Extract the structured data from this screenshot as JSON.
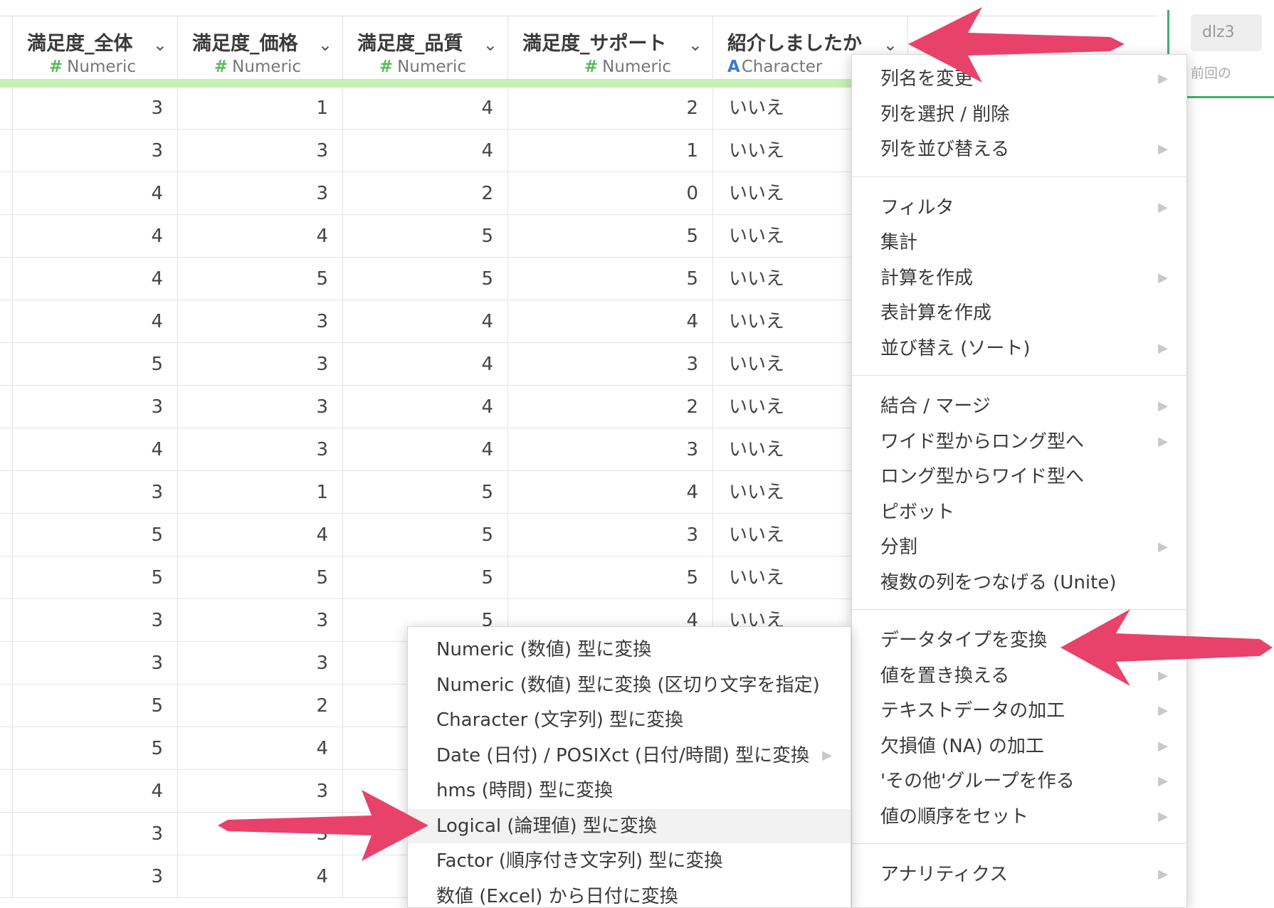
{
  "columns": [
    {
      "name": "満足度_全体",
      "type": "Numeric",
      "kind": "num"
    },
    {
      "name": "満足度_価格",
      "type": "Numeric",
      "kind": "num"
    },
    {
      "name": "満足度_品質",
      "type": "Numeric",
      "kind": "num"
    },
    {
      "name": "満足度_サポート",
      "type": "Numeric",
      "kind": "num"
    },
    {
      "name": "紹介しましたか",
      "type": "Character",
      "kind": "chr"
    }
  ],
  "rows": [
    [
      "3",
      "1",
      "4",
      "2",
      "いいえ"
    ],
    [
      "3",
      "3",
      "4",
      "1",
      "いいえ"
    ],
    [
      "4",
      "3",
      "2",
      "0",
      "いいえ"
    ],
    [
      "4",
      "4",
      "5",
      "5",
      "いいえ"
    ],
    [
      "4",
      "5",
      "5",
      "5",
      "いいえ"
    ],
    [
      "4",
      "3",
      "4",
      "4",
      "いいえ"
    ],
    [
      "5",
      "3",
      "4",
      "3",
      "いいえ"
    ],
    [
      "3",
      "3",
      "4",
      "2",
      "いいえ"
    ],
    [
      "4",
      "3",
      "4",
      "3",
      "いいえ"
    ],
    [
      "3",
      "1",
      "5",
      "4",
      "いいえ"
    ],
    [
      "5",
      "4",
      "5",
      "3",
      "いいえ"
    ],
    [
      "5",
      "5",
      "5",
      "5",
      "いいえ"
    ],
    [
      "3",
      "3",
      "5",
      "4",
      "いいえ"
    ],
    [
      "3",
      "3",
      "",
      "",
      ""
    ],
    [
      "5",
      "2",
      "",
      "",
      ""
    ],
    [
      "5",
      "4",
      "",
      "",
      ""
    ],
    [
      "4",
      "3",
      "",
      "",
      ""
    ],
    [
      "3",
      "3",
      "",
      "",
      ""
    ],
    [
      "3",
      "4",
      "",
      "",
      ""
    ]
  ],
  "side_panel": {
    "chip_text": "dlz3",
    "note_text": "前回の"
  },
  "context_menu": {
    "groups": [
      [
        {
          "label": "列名を変更",
          "submenu": true
        },
        {
          "label": "列を選択 / 削除",
          "submenu": false
        },
        {
          "label": "列を並び替える",
          "submenu": true
        }
      ],
      [
        {
          "label": "フィルタ",
          "submenu": true
        },
        {
          "label": "集計",
          "submenu": false
        },
        {
          "label": "計算を作成",
          "submenu": true
        },
        {
          "label": "表計算を作成",
          "submenu": false
        },
        {
          "label": "並び替え (ソート)",
          "submenu": true
        }
      ],
      [
        {
          "label": "結合 / マージ",
          "submenu": true
        },
        {
          "label": "ワイド型からロング型へ",
          "submenu": true
        },
        {
          "label": "ロング型からワイド型へ",
          "submenu": false
        },
        {
          "label": "ピボット",
          "submenu": false
        },
        {
          "label": "分割",
          "submenu": true
        },
        {
          "label": "複数の列をつなげる (Unite)",
          "submenu": false
        }
      ],
      [
        {
          "label": "データタイプを変換",
          "submenu": true
        },
        {
          "label": "値を置き換える",
          "submenu": true
        },
        {
          "label": "テキストデータの加工",
          "submenu": true
        },
        {
          "label": "欠損値 (NA) の加工",
          "submenu": true
        },
        {
          "label": "'その他'グループを作る",
          "submenu": true
        },
        {
          "label": "値の順序をセット",
          "submenu": true
        }
      ],
      [
        {
          "label": "アナリティクス",
          "submenu": true
        }
      ]
    ]
  },
  "type_menu": {
    "items": [
      {
        "label": "Numeric (数値) 型に変換",
        "submenu": false,
        "highlight": false
      },
      {
        "label": "Numeric (数値) 型に変換 (区切り文字を指定)",
        "submenu": false,
        "highlight": false
      },
      {
        "label": "Character (文字列) 型に変換",
        "submenu": false,
        "highlight": false
      },
      {
        "label": "Date (日付) / POSIXct (日付/時間) 型に変換",
        "submenu": true,
        "highlight": false
      },
      {
        "label": "hms (時間) 型に変換",
        "submenu": false,
        "highlight": false
      },
      {
        "label": "Logical (論理値) 型に変換",
        "submenu": false,
        "highlight": true
      },
      {
        "label": "Factor (順序付き文字列) 型に変換",
        "submenu": false,
        "highlight": false
      },
      {
        "label": "数値 (Excel) から日付に変換",
        "submenu": false,
        "highlight": false
      }
    ]
  },
  "colors": {
    "annotation_arrow": "#e8426a",
    "numeric_hash": "#5cb85c",
    "character_a": "#3a7bd5",
    "header_strip": "#c5f0b6"
  }
}
